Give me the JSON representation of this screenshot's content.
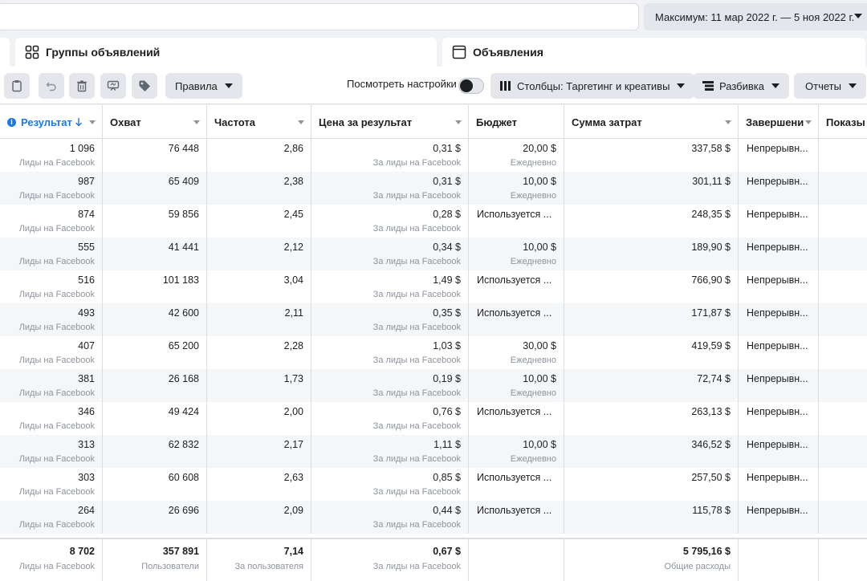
{
  "date_range": "Максимум: 11 мар 2022 г. — 5 ноя 2022 г.",
  "tabs": {
    "adsets": "Группы объявлений",
    "ads": "Объявления"
  },
  "toolbar": {
    "rules": "Правила",
    "view_settings": "Посмотреть настройки",
    "columns": "Столбцы: Таргетинг и креативы",
    "breakdown": "Разбивка",
    "reports": "Отчеты"
  },
  "columns": [
    "Результат",
    "Охват",
    "Частота",
    "Цена за результат",
    "Бюджет",
    "Сумма затрат",
    "Завершени",
    "Показы"
  ],
  "rows": [
    {
      "result": "1 096",
      "result_sub": "Лиды на Facebook",
      "reach": "76 448",
      "freq": "2,86",
      "cpr": "0,31 $",
      "cpr_sub": "За лиды на Facebook",
      "budget": "20,00 $",
      "budget_sub": "Ежедневно",
      "spent": "337,58 $",
      "end": "Непрерывн..."
    },
    {
      "result": "987",
      "result_sub": "Лиды на Facebook",
      "reach": "65 409",
      "freq": "2,38",
      "cpr": "0,31 $",
      "cpr_sub": "За лиды на Facebook",
      "budget": "10,00 $",
      "budget_sub": "Ежедневно",
      "spent": "301,11 $",
      "end": "Непрерывн..."
    },
    {
      "result": "874",
      "result_sub": "Лиды на Facebook",
      "reach": "59 856",
      "freq": "2,45",
      "cpr": "0,28 $",
      "cpr_sub": "За лиды на Facebook",
      "budget_text": "Используется ...",
      "spent": "248,35 $",
      "end": "Непрерывн..."
    },
    {
      "result": "555",
      "result_sub": "Лиды на Facebook",
      "reach": "41 441",
      "freq": "2,12",
      "cpr": "0,34 $",
      "cpr_sub": "За лиды на Facebook",
      "budget": "10,00 $",
      "budget_sub": "Ежедневно",
      "spent": "189,90 $",
      "end": "Непрерывн..."
    },
    {
      "result": "516",
      "result_sub": "Лиды на Facebook",
      "reach": "101 183",
      "freq": "3,04",
      "cpr": "1,49 $",
      "cpr_sub": "За лиды на Facebook",
      "budget_text": "Используется ...",
      "spent": "766,90 $",
      "end": "Непрерывн..."
    },
    {
      "result": "493",
      "result_sub": "Лиды на Facebook",
      "reach": "42 600",
      "freq": "2,11",
      "cpr": "0,35 $",
      "cpr_sub": "За лиды на Facebook",
      "budget_text": "Используется ...",
      "spent": "171,87 $",
      "end": "Непрерывн..."
    },
    {
      "result": "407",
      "result_sub": "Лиды на Facebook",
      "reach": "65 200",
      "freq": "2,28",
      "cpr": "1,03 $",
      "cpr_sub": "За лиды на Facebook",
      "budget": "30,00 $",
      "budget_sub": "Ежедневно",
      "spent": "419,59 $",
      "end": "Непрерывн..."
    },
    {
      "result": "381",
      "result_sub": "Лиды на Facebook",
      "reach": "26 168",
      "freq": "1,73",
      "cpr": "0,19 $",
      "cpr_sub": "За лиды на Facebook",
      "budget": "10,00 $",
      "budget_sub": "Ежедневно",
      "spent": "72,74 $",
      "end": "Непрерывн..."
    },
    {
      "result": "346",
      "result_sub": "Лиды на Facebook",
      "reach": "49 424",
      "freq": "2,00",
      "cpr": "0,76 $",
      "cpr_sub": "За лиды на Facebook",
      "budget_text": "Используется ...",
      "spent": "263,13 $",
      "end": "Непрерывн..."
    },
    {
      "result": "313",
      "result_sub": "Лиды на Facebook",
      "reach": "62 832",
      "freq": "2,17",
      "cpr": "1,11 $",
      "cpr_sub": "За лиды на Facebook",
      "budget": "10,00 $",
      "budget_sub": "Ежедневно",
      "spent": "346,52 $",
      "end": "Непрерывн..."
    },
    {
      "result": "303",
      "result_sub": "Лиды на Facebook",
      "reach": "60 608",
      "freq": "2,63",
      "cpr": "0,85 $",
      "cpr_sub": "За лиды на Facebook",
      "budget_text": "Используется ...",
      "spent": "257,50 $",
      "end": "Непрерывн..."
    },
    {
      "result": "264",
      "result_sub": "Лиды на Facebook",
      "reach": "26 696",
      "freq": "2,09",
      "cpr": "0,44 $",
      "cpr_sub": "За лиды на Facebook",
      "budget_text": "Используется ...",
      "spent": "115,78 $",
      "end": "Непрерывн..."
    }
  ],
  "totals": {
    "result": "8 702",
    "result_sub": "Лиды на Facebook",
    "reach": "357 891",
    "reach_sub": "Пользователи",
    "freq": "7,14",
    "freq_sub": "За пользователя",
    "cpr": "0,67 $",
    "cpr_sub": "За лиды на Facebook",
    "spent": "5 795,16 $",
    "spent_sub": "Общие расходы"
  },
  "colors": {
    "accent": "#1877f2",
    "border": "#dadde1",
    "muted": "#8d949e"
  }
}
